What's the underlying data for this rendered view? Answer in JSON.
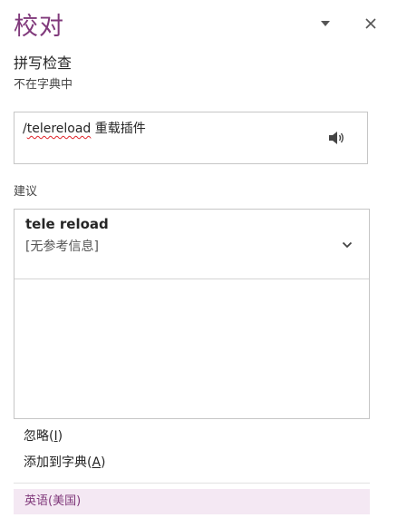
{
  "pane": {
    "title": "校对",
    "menu_icon": "triangle-down-icon",
    "close_icon": "close-icon",
    "accent_color": "#80397b"
  },
  "spelling": {
    "heading": "拼写检查",
    "status": "不在字典中",
    "context": {
      "prefix": "/",
      "misspelled_word": "telereload",
      "suffix": " 重载插件",
      "speaker_icon": "speaker-icon"
    }
  },
  "suggestions": {
    "label": "建议",
    "items": [
      {
        "word": "tele reload",
        "definition": "[无参考信息]",
        "expand_icon": "chevron-down-icon"
      }
    ]
  },
  "actions": {
    "ignore": {
      "label": "忽略(",
      "key": "I",
      "close": ")"
    },
    "add_to_dictionary": {
      "label": "添加到字典(",
      "key": "A",
      "close": ")"
    }
  },
  "language": {
    "label": "英语(美国)",
    "highlight_color": "#f4e8f3"
  }
}
